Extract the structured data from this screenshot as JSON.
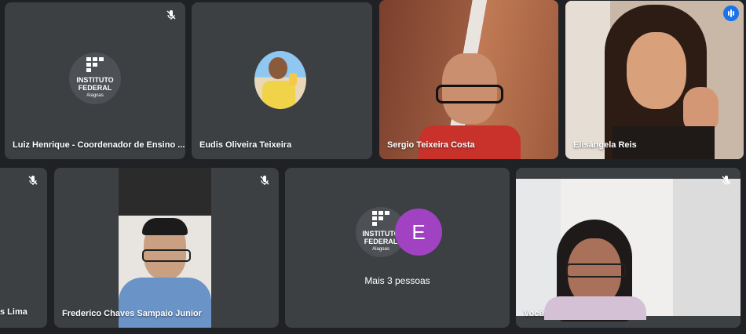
{
  "participants": [
    {
      "name": "Luiz Henrique - Coordenador de Ensino ...",
      "muted": true,
      "avatar": "instituto-federal-logo"
    },
    {
      "name": "Eudis Oliveira Teixeira",
      "muted": false,
      "avatar": "profile-photo"
    },
    {
      "name": "Sergio Teixeira Costa",
      "muted": false,
      "avatar": "camera-video"
    },
    {
      "name": "Elisângela Reis",
      "muted": false,
      "speaking": true,
      "avatar": "camera-video"
    },
    {
      "name": "s Lima",
      "muted": true,
      "avatar": "none"
    },
    {
      "name": "Frederico Chaves Sampaio Junior",
      "muted": true,
      "avatar": "camera-video"
    },
    {
      "name": "Mais 3 pessoas",
      "avatar_letter": "E"
    },
    {
      "name": "Você",
      "muted": true,
      "avatar": "camera-video"
    }
  ],
  "logo": {
    "line1": "INSTITUTO",
    "line2": "FEDERAL",
    "line3": "Alagoas"
  },
  "colors": {
    "background": "#202124",
    "tile": "#3c4043",
    "accent": "#1a73e8",
    "avatar_e": "#a142c3"
  }
}
